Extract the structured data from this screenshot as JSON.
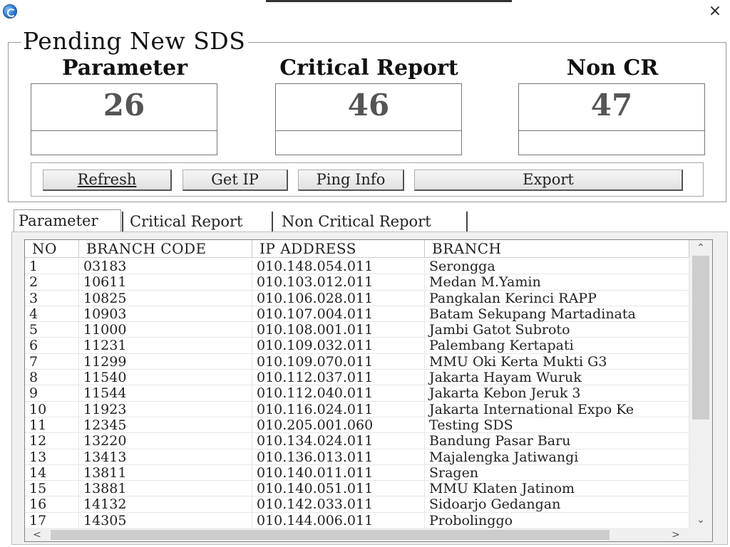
{
  "window": {
    "close_glyph": "×",
    "icon": "app-icon"
  },
  "summary": {
    "group_title": "Pending New SDS",
    "stats": [
      {
        "label": "Parameter",
        "value": "26"
      },
      {
        "label": "Critical Report",
        "value": "46"
      },
      {
        "label": "Non CR",
        "value": "47"
      }
    ]
  },
  "buttons": {
    "refresh": "Refresh",
    "get_ip": "Get IP",
    "ping_info": "Ping Info",
    "export": "Export"
  },
  "tabs": [
    {
      "label": "Parameter",
      "active": true
    },
    {
      "label": "Critical Report",
      "active": false
    },
    {
      "label": "Non Critical Report",
      "active": false
    }
  ],
  "grid": {
    "columns": [
      "NO",
      "BRANCH CODE",
      "IP ADDRESS",
      "BRANCH"
    ],
    "rows": [
      [
        "1",
        "03183",
        "010.148.054.011",
        "Serongga"
      ],
      [
        "2",
        "10611",
        "010.103.012.011",
        "Medan M.Yamin"
      ],
      [
        "3",
        "10825",
        "010.106.028.011",
        "Pangkalan Kerinci RAPP"
      ],
      [
        "4",
        "10903",
        "010.107.004.011",
        "Batam Sekupang Martadinata"
      ],
      [
        "5",
        "11000",
        "010.108.001.011",
        "Jambi Gatot Subroto"
      ],
      [
        "6",
        "11231",
        "010.109.032.011",
        "Palembang Kertapati"
      ],
      [
        "7",
        "11299",
        "010.109.070.011",
        "MMU Oki Kerta Mukti G3"
      ],
      [
        "8",
        "11540",
        "010.112.037.011",
        "Jakarta Hayam Wuruk"
      ],
      [
        "9",
        "11544",
        "010.112.040.011",
        "Jakarta Kebon Jeruk 3"
      ],
      [
        "10",
        "11923",
        "010.116.024.011",
        "Jakarta International Expo Ke"
      ],
      [
        "11",
        "12345",
        "010.205.001.060",
        "Testing SDS"
      ],
      [
        "12",
        "13220",
        "010.134.024.011",
        "Bandung Pasar Baru"
      ],
      [
        "13",
        "13413",
        "010.136.013.011",
        "Majalengka Jatiwangi"
      ],
      [
        "14",
        "13811",
        "010.140.011.011",
        "Sragen"
      ],
      [
        "15",
        "13881",
        "010.140.051.011",
        "MMU Klaten Jatinom"
      ],
      [
        "16",
        "14132",
        "010.142.033.011",
        "Sidoarjo Gedangan"
      ],
      [
        "17",
        "14305",
        "010.144.006.011",
        "Probolinggo"
      ]
    ]
  },
  "scroll": {
    "up": "⌃",
    "down": "⌄",
    "left": "<",
    "right": ">"
  }
}
